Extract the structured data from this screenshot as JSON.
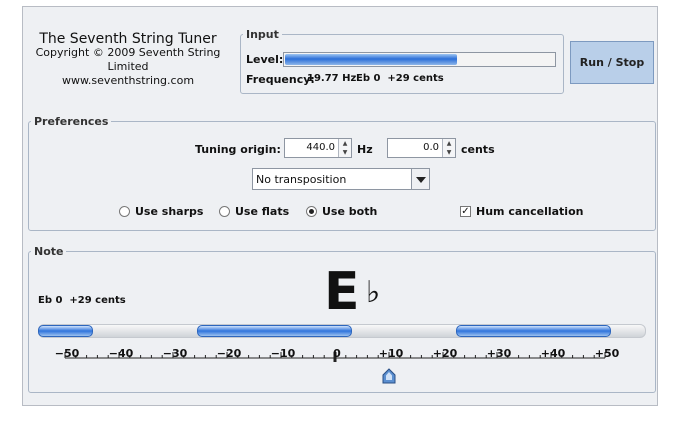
{
  "app": {
    "title": "The Seventh String Tuner",
    "copyright": "Copyright © 2009 Seventh String Limited",
    "website": "www.seventhstring.com"
  },
  "input": {
    "legend": "Input",
    "level_label": "Level:",
    "level_fraction": 0.64,
    "frequency_label": "Frequency:",
    "frequency_value": "19.77 Hz",
    "note_reading": "Eb 0  +29 cents"
  },
  "run_button": {
    "label": "Run / Stop"
  },
  "preferences": {
    "legend": "Preferences",
    "tuning_origin_label": "Tuning origin:",
    "origin_hz_value": "440.0",
    "hz_unit": "Hz",
    "cents_value": "0.0",
    "cents_unit": "cents",
    "transposition_selected": "No transposition",
    "radio_sharps": "Use sharps",
    "radio_flats": "Use flats",
    "radio_both": "Use both",
    "radio_selected": "both",
    "hum_label": "Hum cancellation",
    "hum_checked": true
  },
  "note": {
    "legend": "Note",
    "reading": "Eb 0  +29 cents",
    "letter": "E",
    "accidental": "♭",
    "scale_ticks": [
      "−50",
      "−40",
      "−30",
      "−20",
      "−10",
      "0",
      "+10",
      "+20",
      "+30",
      "+40",
      "+50"
    ],
    "pointer_cents": 10
  }
}
